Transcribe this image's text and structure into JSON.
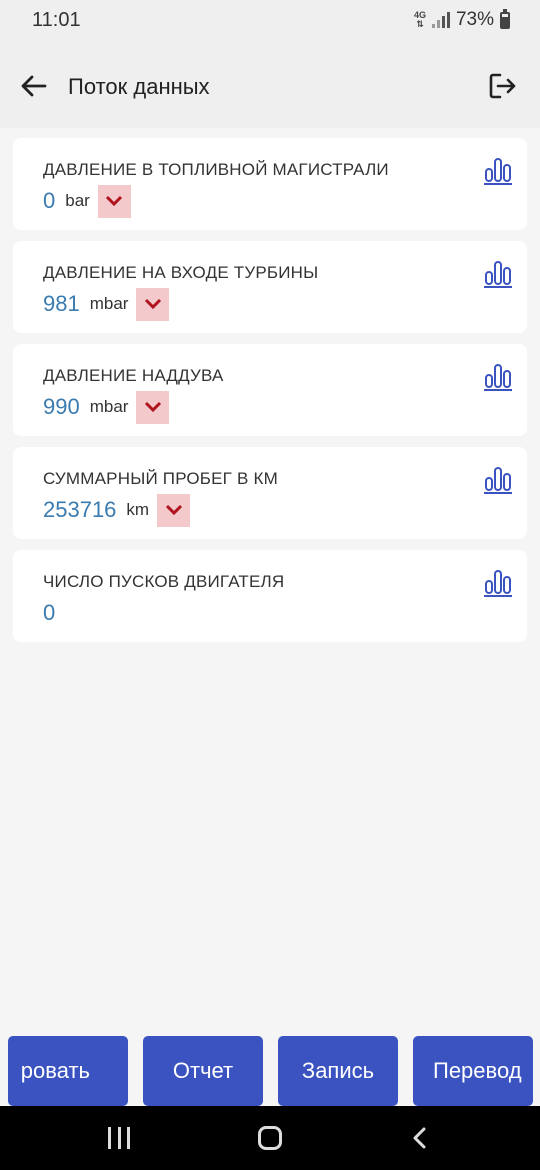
{
  "status": {
    "time": "11:01",
    "network": "4G",
    "battery": "73%"
  },
  "header": {
    "title": "Поток данных"
  },
  "params": [
    {
      "label": "ДАВЛЕНИЕ В ТОПЛИВНОЙ МАГИСТРАЛИ",
      "value": "0",
      "unit": "bar",
      "has_dropdown": true
    },
    {
      "label": "ДАВЛЕНИЕ НА ВХОДЕ ТУРБИНЫ",
      "value": "981",
      "unit": "mbar",
      "has_dropdown": true
    },
    {
      "label": "ДАВЛЕНИЕ НАДДУВА",
      "value": "990",
      "unit": "mbar",
      "has_dropdown": true
    },
    {
      "label": "СУММАРНЫЙ ПРОБЕГ В КМ",
      "value": "253716",
      "unit": "km",
      "has_dropdown": true
    },
    {
      "label": "ЧИСЛО ПУСКОВ ДВИГАТЕЛЯ",
      "value": "0",
      "unit": "",
      "has_dropdown": false
    }
  ],
  "bottom_buttons": [
    "ровать",
    "Отчет",
    "Запись",
    "Перевод"
  ],
  "colors": {
    "accent": "#3a53c0",
    "value": "#3a7bb0",
    "dropdown_bg": "#f3c9cc",
    "dropdown_icon": "#b0141e"
  }
}
